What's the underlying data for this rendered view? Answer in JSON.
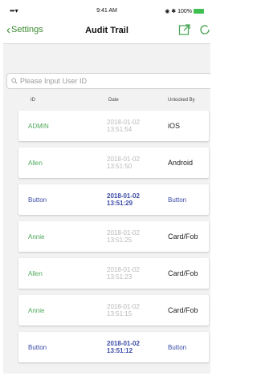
{
  "status": {
    "signal": "••• ▾",
    "time": "9:41 AM",
    "right": "◉ ✱ 100%"
  },
  "nav": {
    "back_label": "Settings",
    "title": "Audit Trail"
  },
  "search": {
    "placeholder": "Please Input User ID",
    "value": ""
  },
  "table": {
    "headers": {
      "id": "ID",
      "date": "Date",
      "unlocked": "Unlocked By"
    },
    "rows": [
      {
        "id": "ADMIN",
        "date": "2018-01-02",
        "time": "13:51:54",
        "unlocked": "iOS",
        "style": "green"
      },
      {
        "id": "Allen",
        "date": "2018-01-02",
        "time": "13:51:50",
        "unlocked": "Android",
        "style": "green"
      },
      {
        "id": "Button",
        "date": "2018-01-02",
        "time": "13:51:29",
        "unlocked": "Button",
        "style": "blue"
      },
      {
        "id": "Annie",
        "date": "2018-01-02",
        "time": "13:51:25",
        "unlocked": "Card/Fob",
        "style": "green"
      },
      {
        "id": "Allen",
        "date": "2018-01-02",
        "time": "13:51:23",
        "unlocked": "Card/Fob",
        "style": "green"
      },
      {
        "id": "Annie",
        "date": "2018-01-02",
        "time": "13:51:15",
        "unlocked": "Card/Fob",
        "style": "green"
      },
      {
        "id": "Button",
        "date": "2018-01-02",
        "time": "13:51:12",
        "unlocked": "Button",
        "style": "blue"
      }
    ]
  },
  "colors": {
    "accent_green": "#4ea85a",
    "accent_blue": "#3a4aa6",
    "battery": "#3fbf4f"
  }
}
